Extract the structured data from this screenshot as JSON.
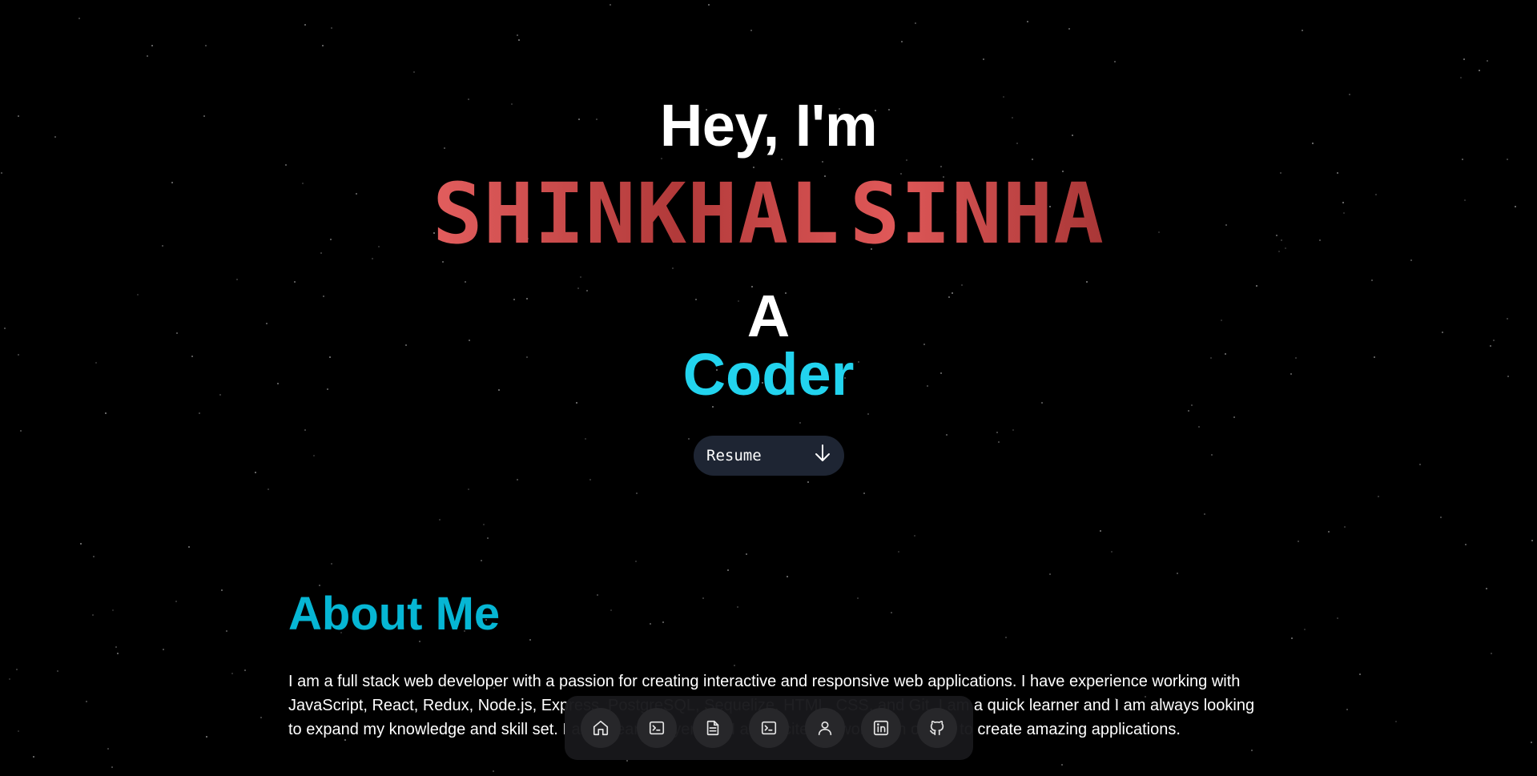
{
  "hero": {
    "greeting": "Hey, I'm",
    "name_first": "SHINKHAL",
    "name_last": "SINHA",
    "article": "A",
    "role": "Coder",
    "resume_label": "Resume"
  },
  "about": {
    "title": "About Me",
    "text": "I am a full stack web developer with a passion for creating interactive and responsive web applications. I have experience working with JavaScript, React, Redux, Node.js, Express, PostgreSQL, Sequelize, HTML, CSS, and Git. I am a quick learner and I am always looking to expand my knowledge and skill set. I am a team player and I am excited to work with others to create amazing applications."
  },
  "dock": {
    "items": [
      {
        "icon": "home-icon"
      },
      {
        "icon": "terminal-icon"
      },
      {
        "icon": "file-text-icon"
      },
      {
        "icon": "terminal-icon"
      },
      {
        "icon": "user-icon"
      },
      {
        "icon": "linkedin-icon"
      },
      {
        "icon": "github-icon"
      }
    ]
  },
  "colors": {
    "background": "#000000",
    "accent": "#22d3ee",
    "about_title": "#06b6d4",
    "name_gradient_light": "#e15a5a",
    "name_gradient_dark": "#a73535",
    "button_bg": "#1e2533",
    "dock_bg": "#18181b",
    "dock_button_bg": "#27272a"
  }
}
